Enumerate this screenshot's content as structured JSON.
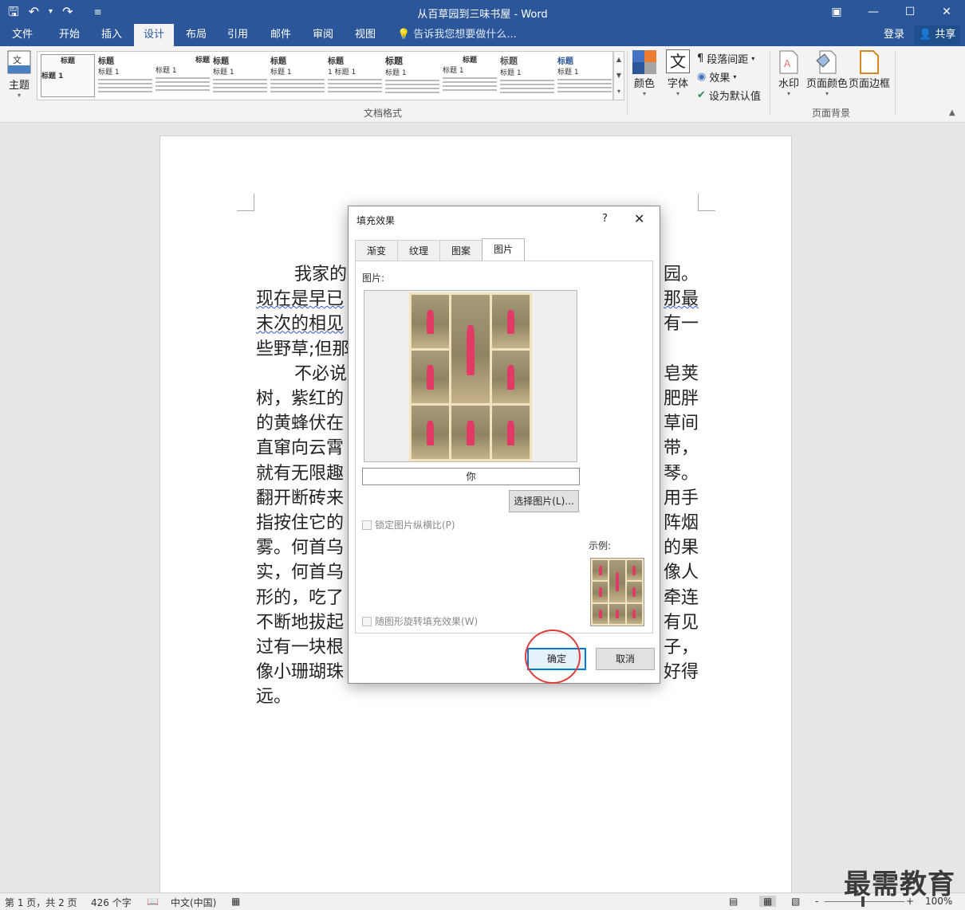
{
  "window": {
    "title": "从百草园到三味书屋 - Word",
    "controls": [
      "▣",
      "—",
      "☐",
      "✕"
    ]
  },
  "qat": {
    "save": "🖫",
    "undo": "↶",
    "undo_arrow": "▾",
    "redo": "↷",
    "customize": "≡"
  },
  "tabs": [
    "文件",
    "开始",
    "插入",
    "设计",
    "布局",
    "引用",
    "邮件",
    "审阅",
    "视图"
  ],
  "active_tab": "设计",
  "tell_me": "告诉我您想要做什么...",
  "login": "登录",
  "share": "共享",
  "ribbon": {
    "theme_label": "主题",
    "gallery_label": "文档格式",
    "gallery_items": [
      {
        "title": "标题",
        "heading": "标题 1"
      },
      {
        "title": "标题",
        "heading": "标题 1"
      },
      {
        "title": "标题",
        "heading": "标题 1"
      },
      {
        "title": "标题",
        "heading": "标题 1"
      },
      {
        "title": "标题",
        "heading": "标题 1"
      },
      {
        "title": "标题",
        "heading": "1 标题 1"
      },
      {
        "title": "标题",
        "heading": "标题 1"
      },
      {
        "title": "标题",
        "heading": "标题 1"
      },
      {
        "title": "标题",
        "heading": "标题 1"
      },
      {
        "title": "标题",
        "heading": "标题 1"
      }
    ],
    "colors_label": "颜色",
    "fonts_label": "字体",
    "paragraph_spacing": "段落间距",
    "effects": "效果",
    "set_default": "设为默认值",
    "watermark": "水印",
    "page_color": "页面颜色",
    "page_borders": "页面边框",
    "page_bg_label": "页面背景"
  },
  "document": {
    "paragraph1_line1": "我家的",
    "paragraph1_line1_end": "园。",
    "line2_start": "现在是早已",
    "line2_end": "那最",
    "line3_start": "末次的相见",
    "line3_end": "有一",
    "line4_start": "些野草;但那",
    "para2_start": "不必说",
    "para2_end": "皂荚",
    "line6_start": "树，紫红的",
    "line6_end": "肥胖",
    "line7_start": "的黄蜂伏在",
    "line7_end": "草间",
    "line8_start": "直窜向云霄",
    "line8_end": "带，",
    "line9_start": "就有无限趣",
    "line9_end": "琴。",
    "line10_start": "翻开断砖来",
    "line10_end": "用手",
    "line11_start": "指按住它的",
    "line11_end": "阵烟",
    "line12_start": "雾。何首乌",
    "line12_end": "的果",
    "line13_start": "实，何首乌",
    "line13_end": "像人",
    "line14_start": "形的，吃了",
    "line14_end": "牵连",
    "line15_start": "不断地拔起",
    "line15_end": "有见",
    "line16_start": "过有一块根",
    "line16_end": "子，",
    "line17_start": "像小珊瑚珠",
    "line17_end": "好得",
    "line18": "远。"
  },
  "dialog": {
    "title": "填充效果",
    "help": "?",
    "close": "✕",
    "tabs": [
      "渐变",
      "纹理",
      "图案",
      "图片"
    ],
    "active_tab": "图片",
    "picture_label": "图片:",
    "picture_name": "你",
    "select_picture": "选择图片(L)...",
    "lock_aspect": "锁定图片纵横比(P)",
    "sample_label": "示例:",
    "rotate_with_shape": "随图形旋转填充效果(W)",
    "ok": "确定",
    "cancel": "取消"
  },
  "status": {
    "page": "第 1 页，共 2 页",
    "words": "426 个字",
    "language": "中文(中国)",
    "zoom": "100%",
    "zoom_minus": "-",
    "zoom_plus": "+"
  },
  "watermark_text": "最需教育"
}
